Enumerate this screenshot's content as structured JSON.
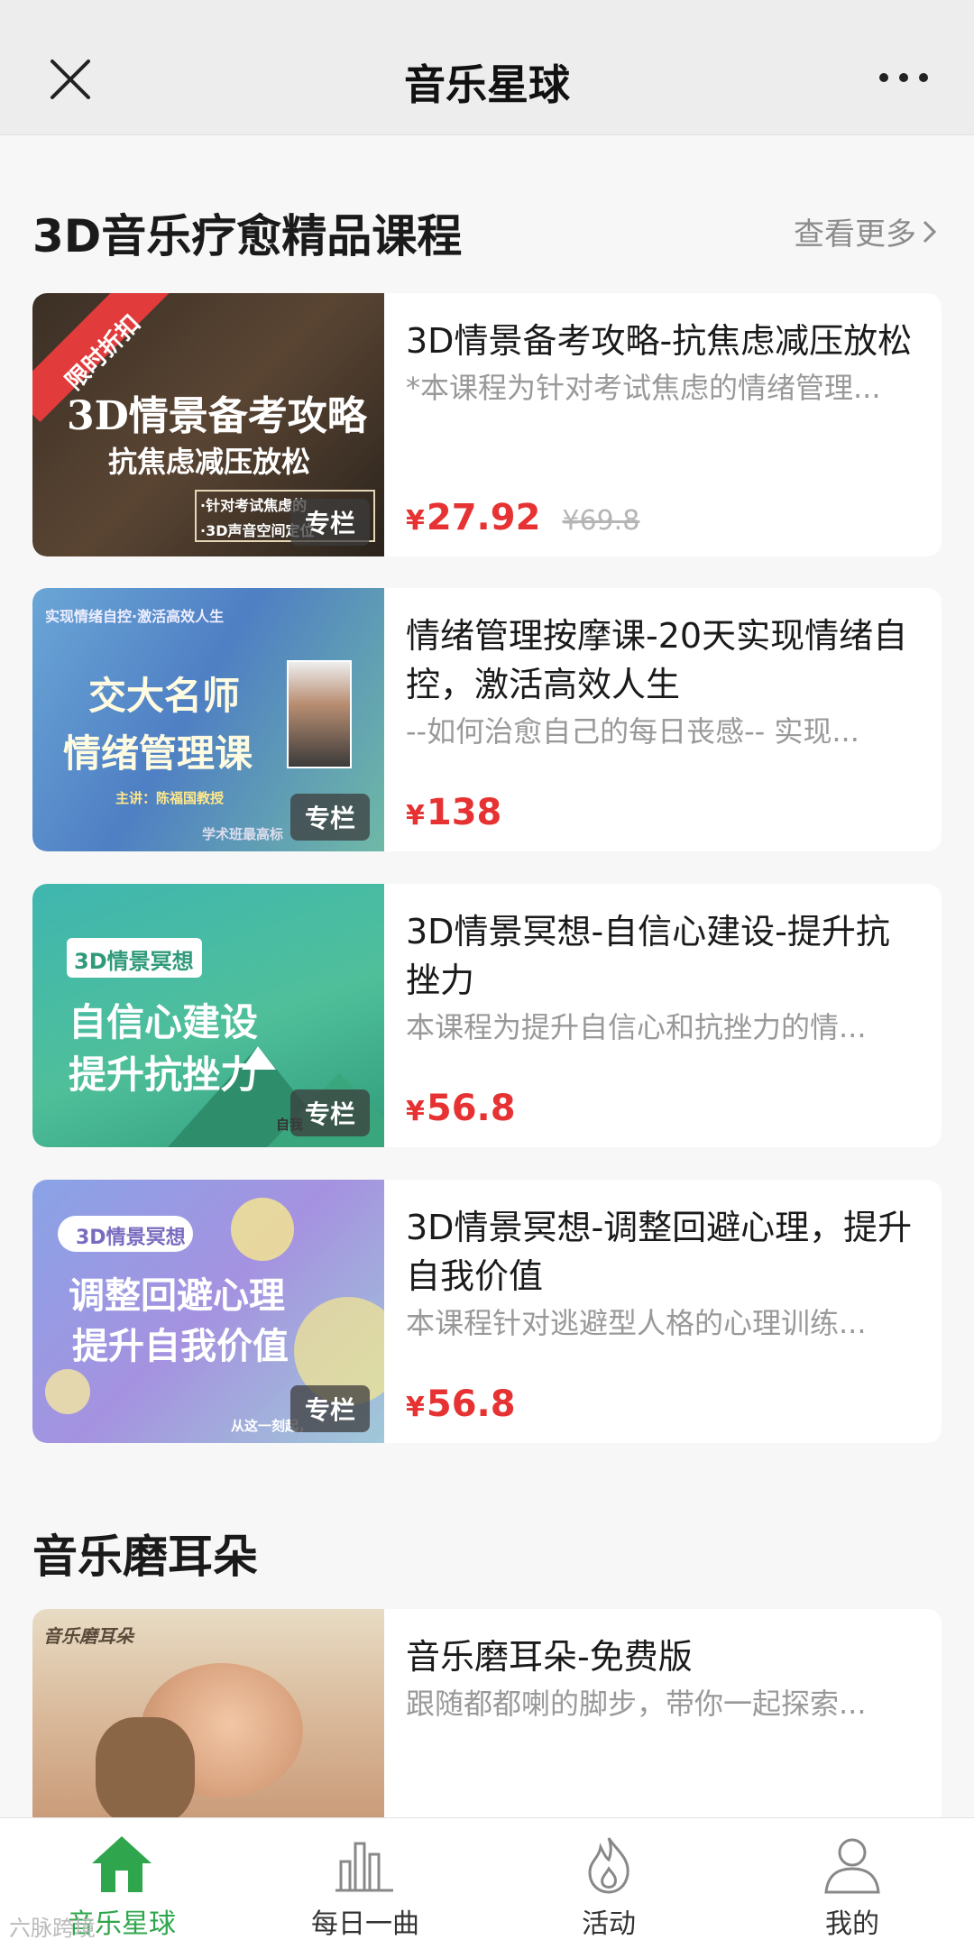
{
  "header": {
    "title": "音乐星球",
    "close_icon": "close-icon",
    "more_icon": "more-icon"
  },
  "section1": {
    "title": "3D音乐疗愈精品课程",
    "see_more": "查看更多"
  },
  "courses": [
    {
      "title": "3D情景备考攻略-抗焦虑减压放松",
      "desc": "*本课程为针对考试焦虑的情绪管理...",
      "price": "27.92",
      "old_price": "¥69.8",
      "thumb_ribbon": "限时折扣",
      "thumb_main": "3D情景备考攻略",
      "thumb_sub": "抗焦虑减压放松",
      "thumb_note1": "·针对考试焦虑的",
      "thumb_note2": "·3D声音空间定位",
      "tag": "专栏"
    },
    {
      "title": "情绪管理按摩课-20天实现情绪自控，激活高效人生",
      "desc": "--如何治愈自己的每日丧感-- 实现...",
      "price": "138",
      "old_price": "",
      "thumb_top": "实现情绪自控·激活高效人生",
      "thumb_main": "交大名师",
      "thumb_sub": "情绪管理课",
      "thumb_note1": "主讲：陈福国教授",
      "thumb_note2": "学术班最高标",
      "tag": "专栏"
    },
    {
      "title": "3D情景冥想-自信心建设-提升抗挫力",
      "desc": "本课程为提升自信心和抗挫力的情...",
      "price": "56.8",
      "old_price": "",
      "thumb_label": "3D情景冥想",
      "thumb_main": "自信心建设",
      "thumb_sub": "提升抗挫力",
      "thumb_note1": "自我",
      "tag": "专栏"
    },
    {
      "title": "3D情景冥想-调整回避心理，提升自我价值",
      "desc": "本课程针对逃避型人格的心理训练...",
      "price": "56.8",
      "old_price": "",
      "thumb_label": "3D情景冥想",
      "thumb_main": "调整回避心理",
      "thumb_sub": "提升自我价值",
      "thumb_note1": "从这一刻起，",
      "tag": "专栏"
    }
  ],
  "section2": {
    "title": "音乐磨耳朵"
  },
  "free_course": {
    "title": "音乐磨耳朵-免费版",
    "desc": "跟随都都喇的脚步，带你一起探索...",
    "thumb_label": "音乐磨耳朵"
  },
  "tabs": [
    {
      "label": "音乐星球",
      "icon": "home-icon",
      "active": true
    },
    {
      "label": "每日一曲",
      "icon": "bars-icon",
      "active": false
    },
    {
      "label": "活动",
      "icon": "flame-icon",
      "active": false
    },
    {
      "label": "我的",
      "icon": "user-icon",
      "active": false
    }
  ],
  "watermark": "六脉跨境",
  "colors": {
    "accent_green": "#2fa64d",
    "price_red": "#e63232"
  }
}
